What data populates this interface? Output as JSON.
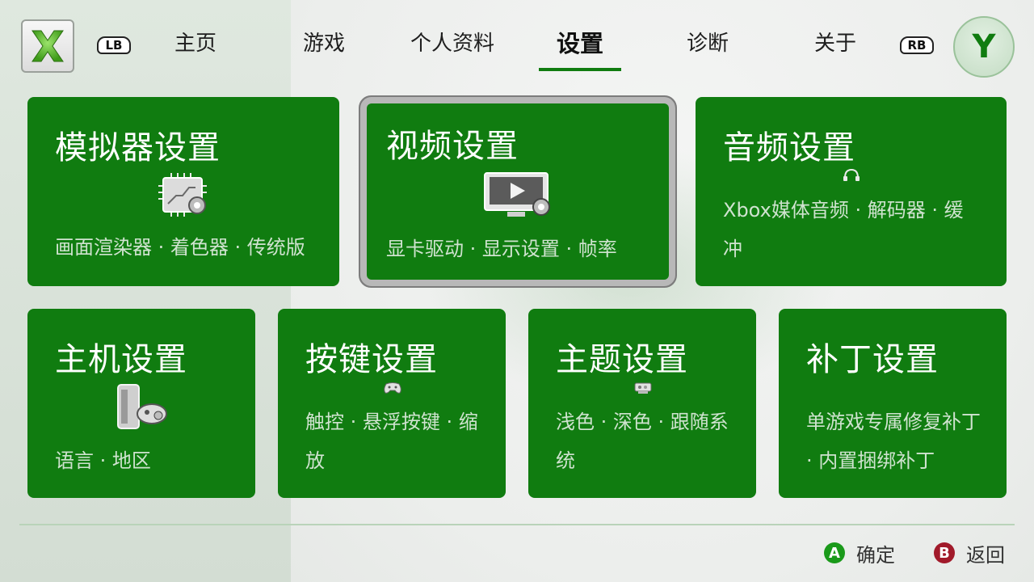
{
  "nav": {
    "lb_label": "LB",
    "rb_label": "RB",
    "y_label": "Y",
    "items": [
      {
        "label": "主页"
      },
      {
        "label": "游戏"
      },
      {
        "label": "个人资料"
      },
      {
        "label": "设置"
      },
      {
        "label": "诊断"
      },
      {
        "label": "关于"
      }
    ],
    "active_index": 3
  },
  "cards": [
    {
      "title": "模拟器设置",
      "desc": "画面渲染器 · 着色器 · 传统版",
      "icon": "chip-gear-icon"
    },
    {
      "title": "视频设置",
      "desc": "显卡驱动 · 显示设置 · 帧率",
      "icon": "monitor-play-icon"
    },
    {
      "title": "音频设置",
      "desc": "Xbox媒体音频 · 解码器 · 缓冲",
      "icon": "headset-icon"
    },
    {
      "title": "主机设置",
      "desc": "语言 · 地区",
      "icon": "console-icon"
    },
    {
      "title": "按键设置",
      "desc": "触控 · 悬浮按键 · 缩放",
      "icon": "gamepad-icon"
    },
    {
      "title": "主题设置",
      "desc": "浅色 · 深色 · 跟随系统",
      "icon": "palette-icon"
    },
    {
      "title": "补丁设置",
      "desc": "单游戏专属修复补丁 · 内置捆绑补丁",
      "icon": ""
    }
  ],
  "footer": {
    "confirm_badge": "A",
    "confirm_label": "确定",
    "back_badge": "B",
    "back_label": "返回"
  },
  "colors": {
    "accent": "#107c10",
    "a_button": "#1a9a1a",
    "b_button": "#a11a2a"
  }
}
